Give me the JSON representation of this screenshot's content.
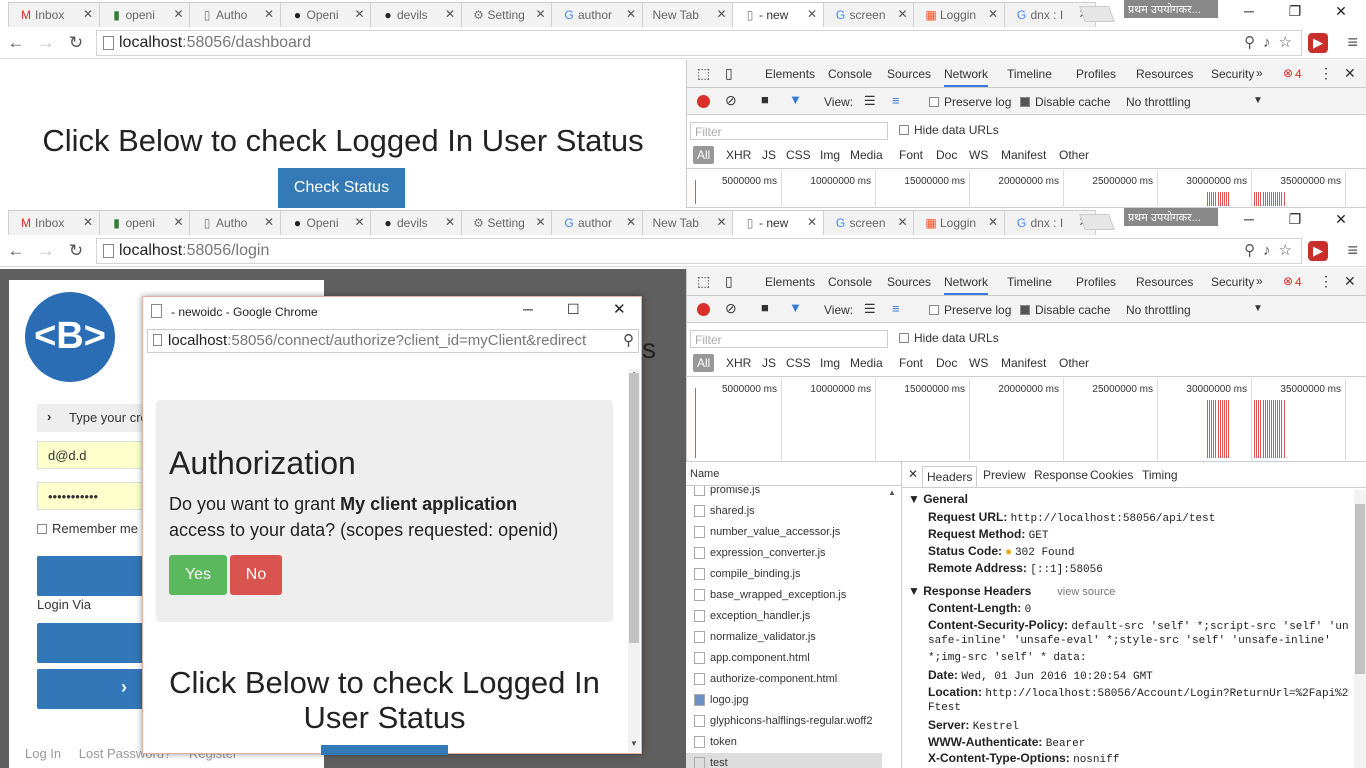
{
  "tabs": [
    {
      "label": "Inbox",
      "icon": "gmail-icon"
    },
    {
      "label": "openi",
      "icon": "openid-icon"
    },
    {
      "label": "Autho",
      "icon": "page-icon"
    },
    {
      "label": "Openi",
      "icon": "github-icon"
    },
    {
      "label": "devils",
      "icon": "github-icon"
    },
    {
      "label": "Setting",
      "icon": "gear-icon"
    },
    {
      "label": "author",
      "icon": "google-icon"
    },
    {
      "label": "New Tab",
      "icon": ""
    },
    {
      "label": "- new",
      "icon": "page-icon"
    },
    {
      "label": "screen",
      "icon": "google-icon"
    },
    {
      "label": "Loggin",
      "icon": "microsoft-icon"
    },
    {
      "label": "dnx : I",
      "icon": "google-icon"
    }
  ],
  "profile_name": "प्रथम उपयोगकर...",
  "window1": {
    "url_host": "localhost",
    "url_path": ":58056/dashboard",
    "heading": "Click Below to check Logged In User Status",
    "button": "Check Status"
  },
  "window2": {
    "url_host": "localhost",
    "url_path": ":58056/login"
  },
  "devtools": {
    "tabs": [
      "Elements",
      "Console",
      "Sources",
      "Network",
      "Timeline",
      "Profiles",
      "Resources",
      "Security"
    ],
    "active_tab": "Network",
    "error_count": "4",
    "view_label": "View:",
    "preserve_log": "Preserve log",
    "disable_cache": "Disable cache",
    "throttling": "No throttling",
    "filter_placeholder": "Filter",
    "hide_data_urls": "Hide data URLs",
    "types": [
      "All",
      "XHR",
      "JS",
      "CSS",
      "Img",
      "Media",
      "Font",
      "Doc",
      "WS",
      "Manifest",
      "Other"
    ],
    "ticks_top": [
      "5000000 ms",
      "10000000 ms",
      "15000000 ms",
      "20000000 ms",
      "25000000 ms",
      "30000000 ms",
      "35000000 ms"
    ],
    "ticks_bottom": [
      "5000000 ms",
      "10000000 ms",
      "15000000 ms",
      "20000000 ms",
      "25000000 ms",
      "30000000 ms",
      "35000000 ms"
    ],
    "name_header": "Name",
    "files": [
      "promise.js",
      "shared.js",
      "number_value_accessor.js",
      "expression_converter.js",
      "compile_binding.js",
      "base_wrapped_exception.js",
      "exception_handler.js",
      "normalize_validator.js",
      "app.component.html",
      "authorize-component.html",
      "logo.jpg",
      "glyphicons-halflings-regular.woff2",
      "token",
      "test"
    ],
    "detail_tabs": [
      "Headers",
      "Preview",
      "Response",
      "Cookies",
      "Timing"
    ],
    "general_title": "General",
    "general": [
      {
        "k": "Request URL:",
        "v": "http://localhost:58056/api/test"
      },
      {
        "k": "Request Method:",
        "v": "GET"
      },
      {
        "k": "Status Code:",
        "v": "302 Found"
      },
      {
        "k": "Remote Address:",
        "v": "[::1]:58056"
      }
    ],
    "response_title": "Response Headers",
    "view_source": "view source",
    "response": [
      {
        "k": "Content-Length:",
        "v": "0"
      },
      {
        "k": "Content-Security-Policy:",
        "v": "default-src 'self' *;script-src 'self' 'un"
      },
      {
        "k": "",
        "v": "safe-inline' 'unsafe-eval' *;style-src 'self' 'unsafe-inline'"
      },
      {
        "k": "",
        "v": "*;img-src 'self' * data:"
      },
      {
        "k": "Date:",
        "v": "Wed, 01 Jun 2016 10:20:54 GMT"
      },
      {
        "k": "Location:",
        "v": "http://localhost:58056/Account/Login?ReturnUrl=%2Fapi%2"
      },
      {
        "k": "",
        "v": "Ftest"
      },
      {
        "k": "Server:",
        "v": "Kestrel"
      },
      {
        "k": "WWW-Authenticate:",
        "v": "Bearer"
      },
      {
        "k": "X-Content-Type-Options:",
        "v": "nosniff"
      }
    ]
  },
  "login": {
    "logo_text": "<B>",
    "prompt": "Type your cre",
    "email": "d@d.d",
    "password": "•••••••••••",
    "remember": "Remember me",
    "login_via": "Login Via",
    "footer_links": [
      "Log In",
      "Lost Password?",
      "Register"
    ]
  },
  "popup": {
    "title": "- newoidc - Google Chrome",
    "url_host": "localhost",
    "url_rest": ":58056/connect/authorize?client_id=myClient&redirect",
    "heading": "Authorization",
    "question_prefix": "Do you want to grant ",
    "client_name": "My client application",
    "question_suffix": "access to your data? (scopes requested: openid)",
    "yes": "Yes",
    "no": "No",
    "lower_heading": "Click Below to check Logged In User Status"
  },
  "colors": {
    "primary": "#337ab7",
    "success": "#5cb85c",
    "danger": "#d9534f",
    "record": "#d9302c"
  }
}
